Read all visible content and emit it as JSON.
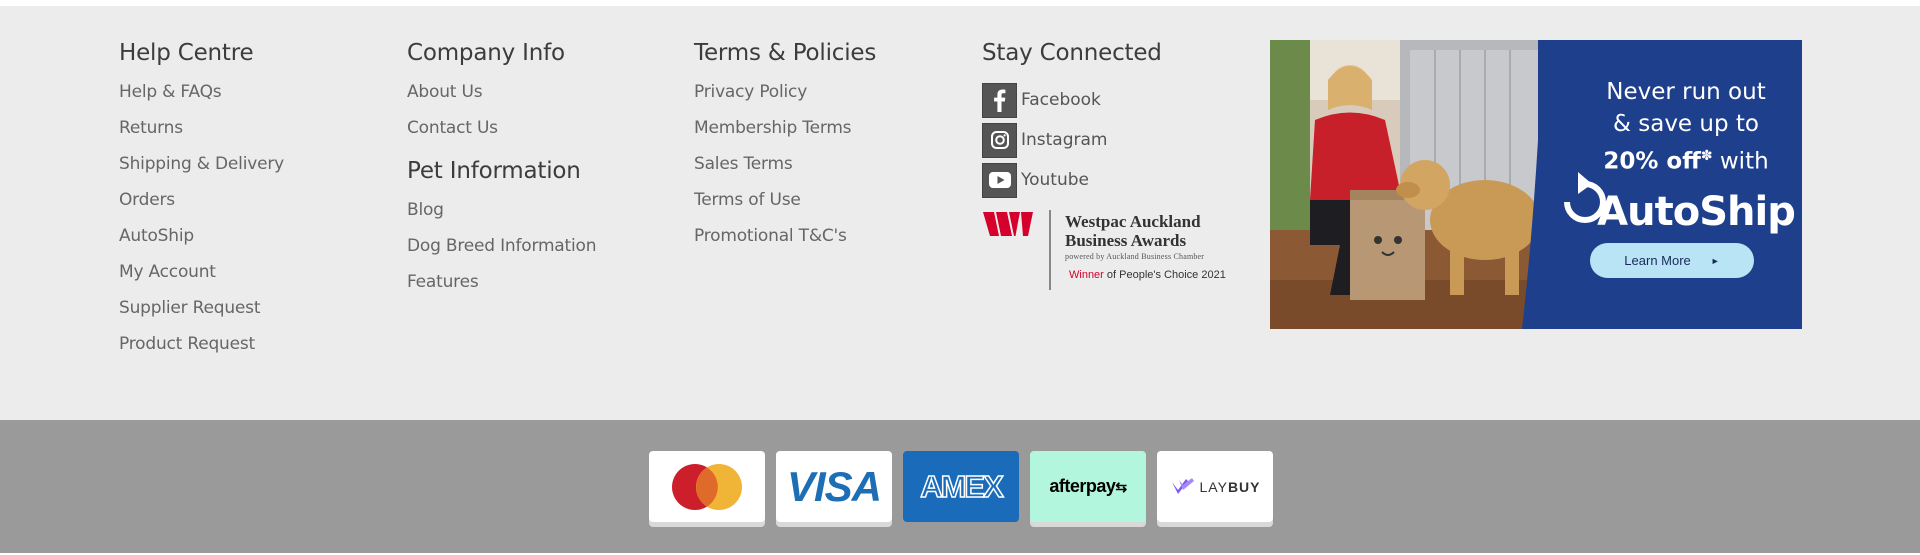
{
  "help_centre": {
    "heading": "Help Centre",
    "links": [
      "Help & FAQs",
      "Returns",
      "Shipping & Delivery",
      "Orders",
      "AutoShip",
      "My Account",
      "Supplier Request",
      "Product Request"
    ]
  },
  "company_info": {
    "heading": "Company Info",
    "links": [
      "About Us",
      "Contact Us"
    ]
  },
  "pet_information": {
    "heading": "Pet Information",
    "links": [
      "Blog",
      "Dog Breed Information",
      "Features"
    ]
  },
  "terms_policies": {
    "heading": "Terms & Policies",
    "links": [
      "Privacy Policy",
      "Membership Terms",
      "Sales Terms",
      "Terms of Use",
      "Promotional T&C's"
    ]
  },
  "stay_connected": {
    "heading": "Stay Connected",
    "social": [
      {
        "label": "Facebook",
        "icon": "facebook-icon"
      },
      {
        "label": "Instagram",
        "icon": "instagram-icon"
      },
      {
        "label": "Youtube",
        "icon": "youtube-icon"
      }
    ]
  },
  "award": {
    "title": "Westpac Auckland Business Awards",
    "subtitle": "powered by Auckland Business Chamber",
    "winner_word": "Winner",
    "winner_rest": " of People's Choice 2021",
    "logo_color": "#d5002b"
  },
  "banner": {
    "line1": "Never run out",
    "line2": "& save up to",
    "line3_bold": "20% off",
    "line3_sup": "✽",
    "line3_rest": " with",
    "logo": "AutoShip",
    "button_label": "Learn More",
    "bg_color": "#1e3f8c",
    "button_color": "#b9e4f5"
  },
  "payments": {
    "cards": [
      {
        "name": "Mastercard",
        "icon": "mastercard-icon"
      },
      {
        "name": "VISA",
        "icon": "visa-icon"
      },
      {
        "name": "AMEX",
        "icon": "amex-icon"
      },
      {
        "name": "afterpay",
        "icon": "afterpay-icon"
      },
      {
        "name": "LAYBUY",
        "icon": "laybuy-icon"
      }
    ],
    "laybuy_lay": "LAY",
    "laybuy_buy": "BUY"
  }
}
